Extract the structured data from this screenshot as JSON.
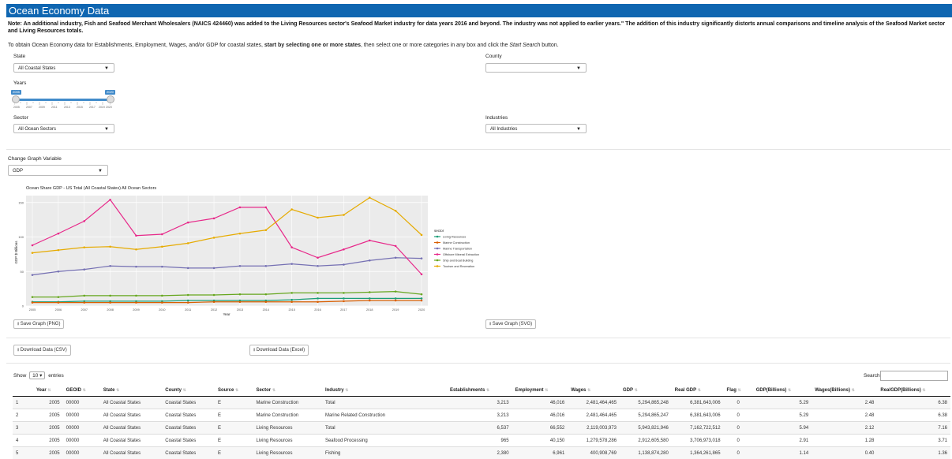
{
  "header": {
    "title": "Ocean Economy Data"
  },
  "note": "Note: An additional industry, Fish and Seafood Merchant Wholesalers (NAICS 424460) was added to the Living Resources sector's Seafood Market industry for data years 2016 and beyond. The industry was not applied to earlier years.\" The addition of this industry significantly distorts annual comparisons and timeline analysis of the Seafood Market sector and Living Resources totals.",
  "intro": {
    "part1": "To obtain Ocean Economy data for Establishments, Employment, Wages, and/or GDP for coastal states, ",
    "bold": "start by selecting one or more states",
    "part2": ", then select one or more categories in any box and click the ",
    "italic": "Start Search",
    "part3": " button."
  },
  "filters": {
    "state_label": "State",
    "state_value": "All Coastal States",
    "county_label": "County",
    "county_value": "",
    "years_label": "Years",
    "year_min": "2005",
    "year_max": "2020",
    "year_ticks": [
      "2005",
      "2007",
      "2009",
      "2011",
      "2013",
      "2015",
      "2017",
      "2019",
      "2020"
    ],
    "sector_label": "Sector",
    "sector_value": "All Ocean Sectors",
    "industries_label": "Industries",
    "industries_value": "All Industries"
  },
  "graph_var": {
    "label": "Change Graph Variable",
    "value": "GDP"
  },
  "buttons": {
    "save_png": "Save Graph (PNG)",
    "save_svg": "Save Graph (SVG)",
    "dl_csv": "Download Data (CSV)",
    "dl_excel": "Download Data (Excel)"
  },
  "table_controls": {
    "show": "Show",
    "entries_value": "10",
    "entries": "entries",
    "search": "Search:"
  },
  "table": {
    "columns": [
      "",
      "Year",
      "GEOID",
      "State",
      "County",
      "Source",
      "Sector",
      "Industry",
      "Establishments",
      "Employment",
      "Wages",
      "GDP",
      "Real GDP",
      "Flag",
      "GDP(Billions)",
      "Wages(Billions)",
      "RealGDP(Billions)"
    ],
    "rows": [
      [
        "1",
        "2005",
        "00000",
        "All Coastal States",
        "Coastal States",
        "E",
        "Marine Construction",
        "Total",
        "3,213",
        "46,016",
        "2,481,464,465",
        "5,294,865,248",
        "6,381,643,006",
        "0",
        "5.29",
        "2.48",
        "6.38"
      ],
      [
        "2",
        "2005",
        "00000",
        "All Coastal States",
        "Coastal States",
        "E",
        "Marine Construction",
        "Marine Related Construction",
        "3,213",
        "46,016",
        "2,481,464,465",
        "5,294,865,247",
        "6,381,643,006",
        "0",
        "5.29",
        "2.48",
        "6.38"
      ],
      [
        "3",
        "2005",
        "00000",
        "All Coastal States",
        "Coastal States",
        "E",
        "Living Resources",
        "Total",
        "6,537",
        "66,552",
        "2,119,003,973",
        "5,943,821,946",
        "7,162,722,512",
        "0",
        "5.94",
        "2.12",
        "7.16"
      ],
      [
        "4",
        "2005",
        "00000",
        "All Coastal States",
        "Coastal States",
        "E",
        "Living Resources",
        "Seafood Processing",
        "965",
        "40,150",
        "1,279,578,286",
        "2,912,605,580",
        "3,706,973,018",
        "0",
        "2.91",
        "1.28",
        "3.71"
      ],
      [
        "5",
        "2005",
        "00000",
        "All Coastal States",
        "Coastal States",
        "E",
        "Living Resources",
        "Fishing",
        "2,380",
        "6,961",
        "400,908,769",
        "1,138,874,280",
        "1,364,261,865",
        "0",
        "1.14",
        "0.40",
        "1.36"
      ]
    ]
  },
  "chart_data": {
    "type": "line",
    "title": "Ocean Share  GDP -  US Total (All Coastal States)  All Ocean Sectors",
    "xlabel": "Year",
    "ylabel": "GDP $ Billions",
    "x": [
      2005,
      2006,
      2007,
      2008,
      2009,
      2010,
      2011,
      2012,
      2013,
      2014,
      2015,
      2016,
      2017,
      2018,
      2019,
      2020
    ],
    "ylim": [
      0,
      160
    ],
    "yticks": [
      0,
      50,
      100,
      150
    ],
    "ytick_labels": [
      "0",
      "50",
      "100",
      "150"
    ],
    "legend_title": "sector",
    "legend_position": "right",
    "series": [
      {
        "name": "Living Resources",
        "color": "#1a9e77",
        "values": [
          6,
          6,
          7,
          7,
          7,
          7,
          8,
          8,
          8,
          8,
          9,
          11,
          11,
          11,
          11,
          11
        ]
      },
      {
        "name": "Marine Construction",
        "color": "#d95f02",
        "values": [
          5,
          5,
          5,
          5,
          5,
          5,
          5,
          6,
          6,
          6,
          6,
          6,
          7,
          8,
          8,
          8
        ]
      },
      {
        "name": "Marine Transportation",
        "color": "#7570b3",
        "values": [
          45,
          50,
          53,
          58,
          57,
          57,
          55,
          55,
          58,
          58,
          61,
          58,
          60,
          66,
          70,
          69
        ]
      },
      {
        "name": "Offshore Mineral Extraction",
        "color": "#e7298a",
        "values": [
          88,
          105,
          123,
          154,
          102,
          104,
          121,
          127,
          143,
          143,
          85,
          70,
          82,
          95,
          87,
          46
        ]
      },
      {
        "name": "Ship and Boat Building",
        "color": "#66a61e",
        "values": [
          13,
          13,
          15,
          15,
          15,
          15,
          16,
          16,
          17,
          17,
          19,
          19,
          19,
          20,
          21,
          17
        ]
      },
      {
        "name": "Tourism and Recreation",
        "color": "#e6ab02",
        "values": [
          77,
          81,
          85,
          86,
          82,
          86,
          91,
          99,
          105,
          110,
          140,
          128,
          132,
          157,
          138,
          103
        ]
      }
    ]
  }
}
